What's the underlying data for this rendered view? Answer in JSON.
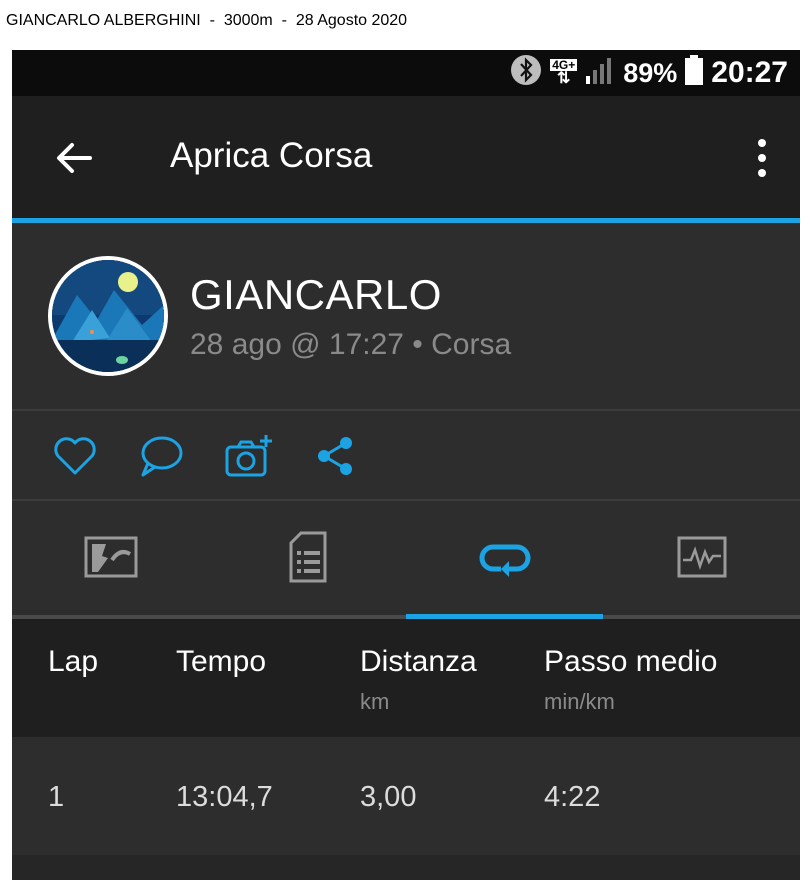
{
  "caption": "GIANCARLO ALBERGHINI  -  3000m  -  28 Agosto 2020",
  "statusbar": {
    "network": "4G+",
    "battery": "89%",
    "time": "20:27",
    "icons": [
      "bluetooth-icon",
      "network-4g-icon",
      "signal-icon",
      "battery-icon"
    ]
  },
  "appbar": {
    "title": "Aprica Corsa",
    "icons": [
      "back-arrow-icon",
      "overflow-menu-icon"
    ]
  },
  "profile": {
    "name": "GIANCARLO",
    "subtitle": "28 ago @ 17:27 • Corsa"
  },
  "actions": [
    "heart-icon",
    "comment-icon",
    "add-photo-icon",
    "share-icon"
  ],
  "tabs": [
    {
      "icon": "map-icon",
      "active": false
    },
    {
      "icon": "details-icon",
      "active": false
    },
    {
      "icon": "laps-icon",
      "active": true
    },
    {
      "icon": "chart-icon",
      "active": false
    }
  ],
  "table": {
    "headers": [
      {
        "label": "Lap",
        "unit": ""
      },
      {
        "label": "Tempo",
        "unit": ""
      },
      {
        "label": "Distanza",
        "unit": "km"
      },
      {
        "label": "Passo medio",
        "unit": "min/km"
      }
    ],
    "rows": [
      [
        "1",
        "13:04,7",
        "3,00",
        "4:22"
      ]
    ]
  },
  "colors": {
    "accent": "#1ba3e3",
    "background": "#2d2d2d",
    "header": "#1f1f1f"
  }
}
